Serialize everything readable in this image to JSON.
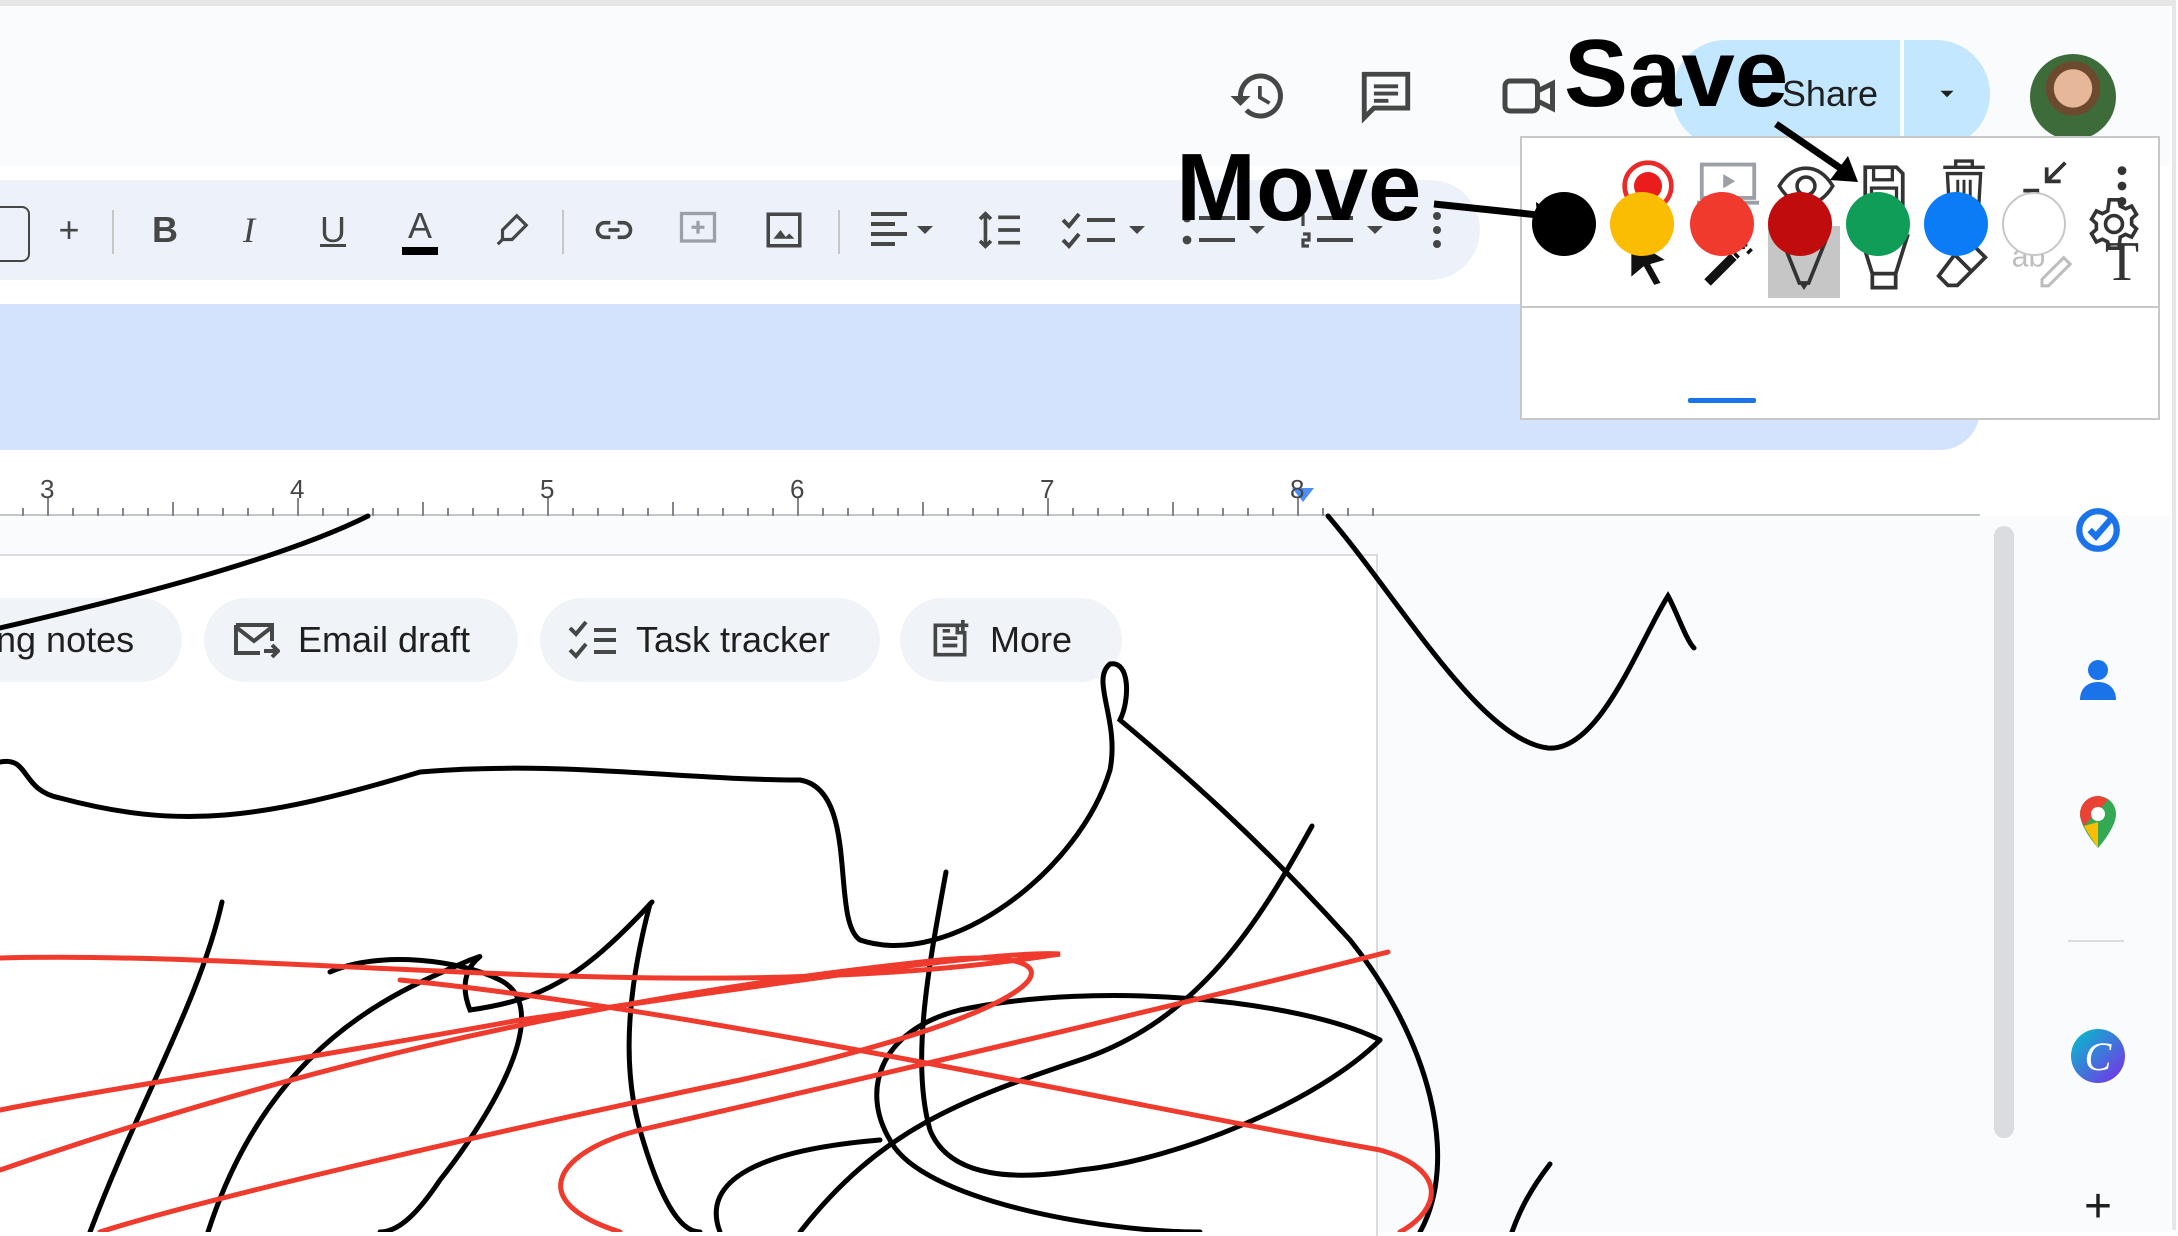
{
  "header": {
    "history_icon": "history-icon",
    "comments_icon": "comment-icon",
    "meet_icon": "video-call-icon",
    "share_label": "Share"
  },
  "toolbar": {
    "items": [
      "plus-icon",
      "bold",
      "italic",
      "underline",
      "text-color",
      "highlighter",
      "link",
      "add-comment",
      "insert-image",
      "align",
      "line-spacing",
      "checklist",
      "bullets",
      "numbering",
      "more-vert"
    ],
    "bold_label": "B",
    "italic_label": "I",
    "underline_label": "U",
    "text_color_label": "A",
    "plus_label": "+"
  },
  "ruler": {
    "numbers": [
      "3",
      "4",
      "5",
      "6",
      "7",
      "8"
    ]
  },
  "chips": [
    {
      "label": "ing notes",
      "icon": "notes-icon"
    },
    {
      "label": "Email draft",
      "icon": "email-icon"
    },
    {
      "label": "Task tracker",
      "icon": "checklist-icon"
    },
    {
      "label": "More",
      "icon": "doc-add-icon"
    }
  ],
  "annotations": {
    "move_label": "Move",
    "save_label": "Save"
  },
  "palette": {
    "colors": [
      "#000000",
      "#fbbc04",
      "#f03a2e",
      "#c00c0c",
      "#0f9d58",
      "#0b7cf5",
      "#ffffff"
    ],
    "selected_color": "#f03a2e",
    "tools_row1": [
      "record",
      "present",
      "preview",
      "save",
      "delete",
      "collapse",
      "more"
    ],
    "tools_row2": [
      "pointer",
      "laser",
      "pen",
      "highlighter",
      "eraser",
      "text-recognize",
      "text"
    ],
    "selected_tool": "pen",
    "text_tool_label": "T"
  },
  "sidebar": {
    "items": [
      "tasks-icon",
      "contacts-icon",
      "maps-icon",
      "canva-icon",
      "add-icon"
    ],
    "canva_label": "C",
    "add_label": "+"
  }
}
